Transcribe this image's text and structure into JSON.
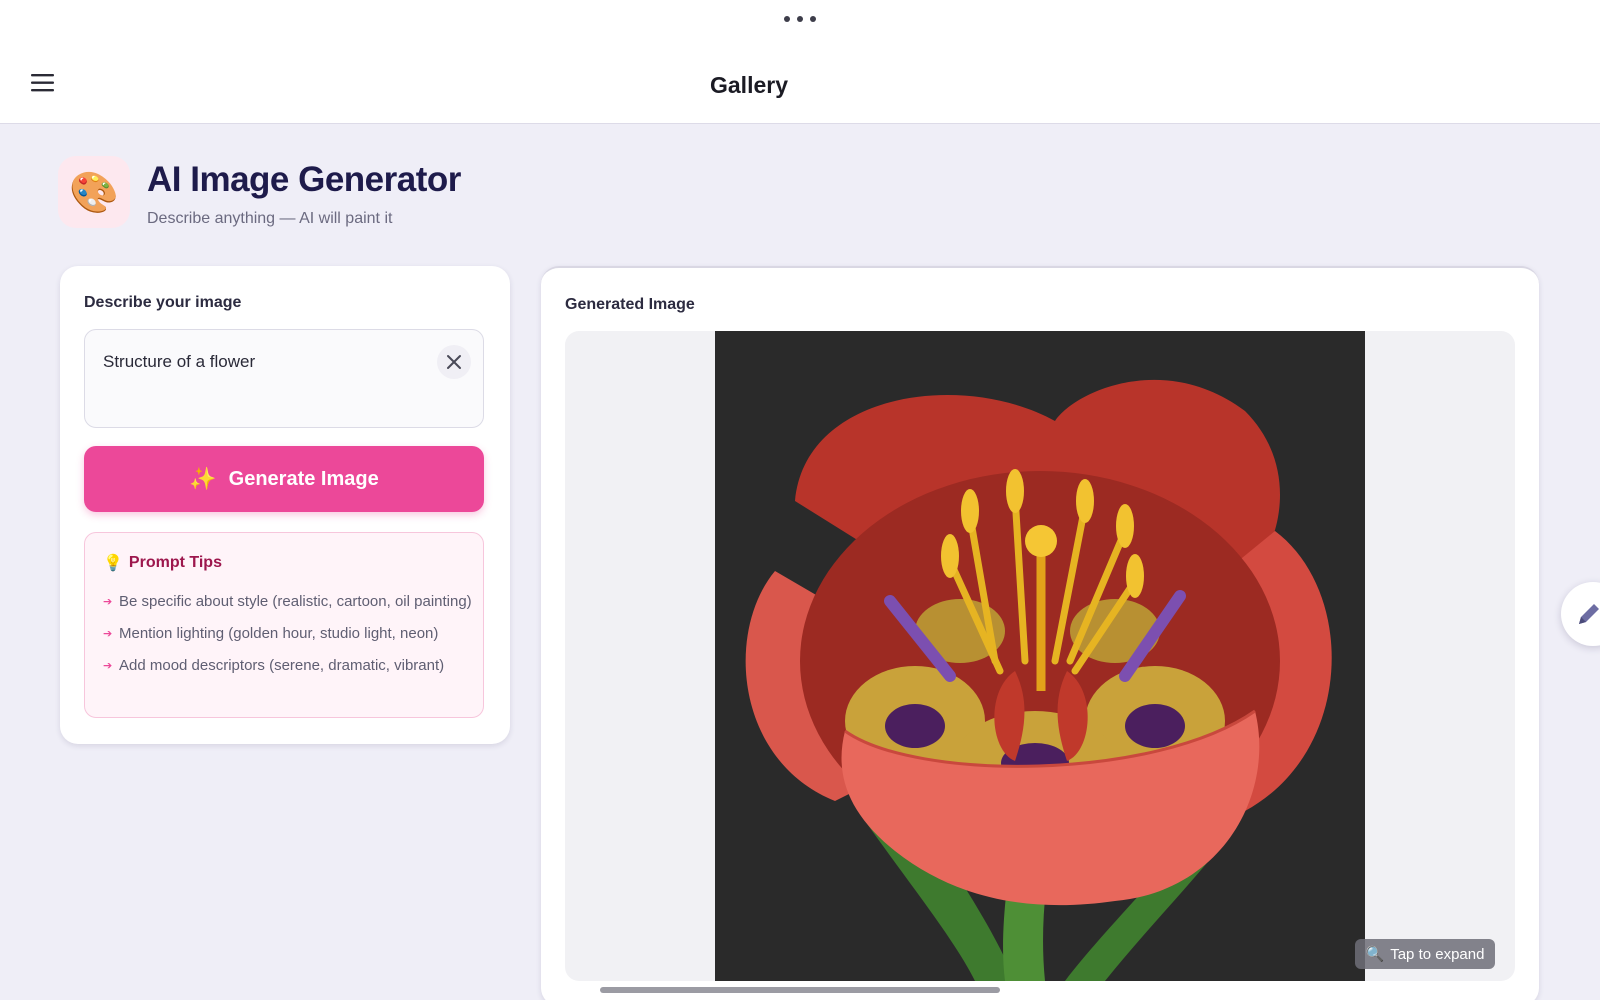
{
  "topbar": {
    "title": "Gallery",
    "menu_icon": "hamburger-menu-icon",
    "more_icon": "more-dots-icon"
  },
  "header": {
    "app_icon": "🎨",
    "title": "AI Image Generator",
    "subtitle": "Describe anything — AI will paint it"
  },
  "prompt_panel": {
    "label": "Describe your image",
    "prompt_value": "Structure of a flower",
    "clear_icon": "close-icon",
    "generate_icon": "✨",
    "generate_label": "Generate Image",
    "tips": {
      "icon": "💡",
      "title": "Prompt Tips",
      "items": [
        "Be specific about style (realistic, cartoon, oil painting)",
        "Mention lighting (golden hour, studio light, neon)",
        "Add mood descriptors (serene, dramatic, vibrant)"
      ]
    }
  },
  "result_panel": {
    "label": "Generated Image",
    "expand_icon": "🔍",
    "expand_label": "Tap to expand"
  },
  "fab": {
    "icon": "pencil-icon"
  },
  "colors": {
    "accent": "#ec4899",
    "tips_title": "#9d174d",
    "background": "#efeef7",
    "title": "#1e1b4b"
  }
}
